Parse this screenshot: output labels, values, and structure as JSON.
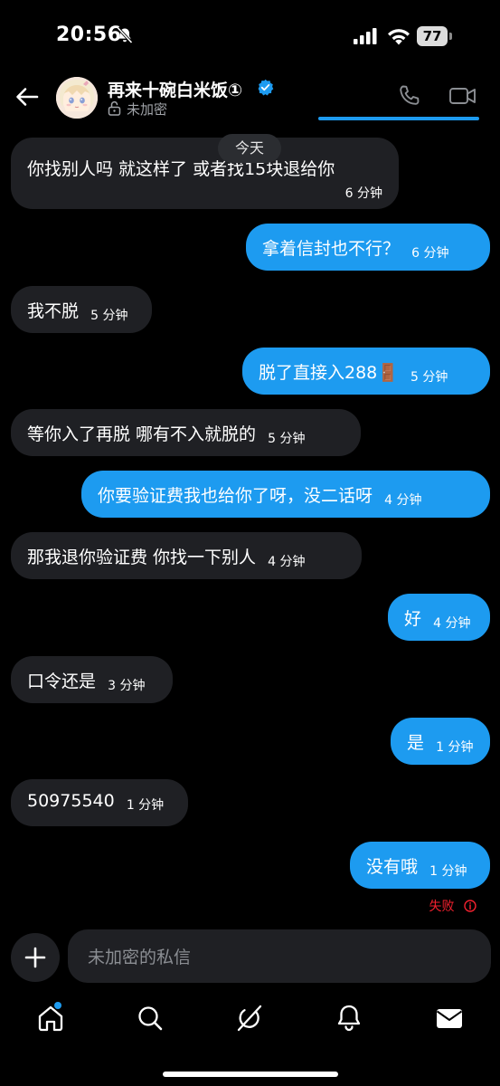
{
  "status_bar": {
    "time": "20:56",
    "battery": "77"
  },
  "header": {
    "contact_name": "再来十碗白米饭①",
    "encryption_label": "未加密"
  },
  "date_separator": "今天",
  "messages": [
    {
      "side": "in",
      "text": "你找别人吗 就这样了 或者找15块退给你",
      "time": "6 分钟"
    },
    {
      "side": "out",
      "text": "拿着信封也不行？",
      "time": "6 分钟"
    },
    {
      "side": "in",
      "text": "我不脱",
      "time": "5 分钟"
    },
    {
      "side": "out",
      "text": "脱了直接入288🚪",
      "time": "5 分钟"
    },
    {
      "side": "in",
      "text": "等你入了再脱 哪有不入就脱的",
      "time": "5 分钟"
    },
    {
      "side": "out",
      "text": "你要验证费我也给你了呀，没二话呀",
      "time": "4 分钟"
    },
    {
      "side": "in",
      "text": "那我退你验证费 你找一下别人",
      "time": "4 分钟"
    },
    {
      "side": "out",
      "text": "好",
      "time": "4 分钟"
    },
    {
      "side": "in",
      "text": "口令还是",
      "time": "3 分钟"
    },
    {
      "side": "out",
      "text": "是",
      "time": "1 分钟"
    },
    {
      "side": "in",
      "text": "50975540",
      "time": "1 分钟"
    },
    {
      "side": "out",
      "text": "没有哦",
      "time": "1 分钟"
    }
  ],
  "failed_label": "失败",
  "composer": {
    "placeholder": "未加密的私信"
  },
  "colors": {
    "accent": "#1d9bf0",
    "incoming_bubble": "#1f2024",
    "error": "#f4212e",
    "background": "#000000"
  },
  "icons": {
    "status": [
      "bell-off-icon",
      "signal-icon",
      "wifi-icon",
      "battery-icon"
    ],
    "header": [
      "back-arrow-icon",
      "verified-badge-icon",
      "lock-open-icon",
      "phone-icon",
      "video-icon"
    ],
    "composer": [
      "plus-icon"
    ],
    "nav": [
      "home-icon",
      "search-icon",
      "grok-icon",
      "bell-icon",
      "mail-icon"
    ]
  }
}
